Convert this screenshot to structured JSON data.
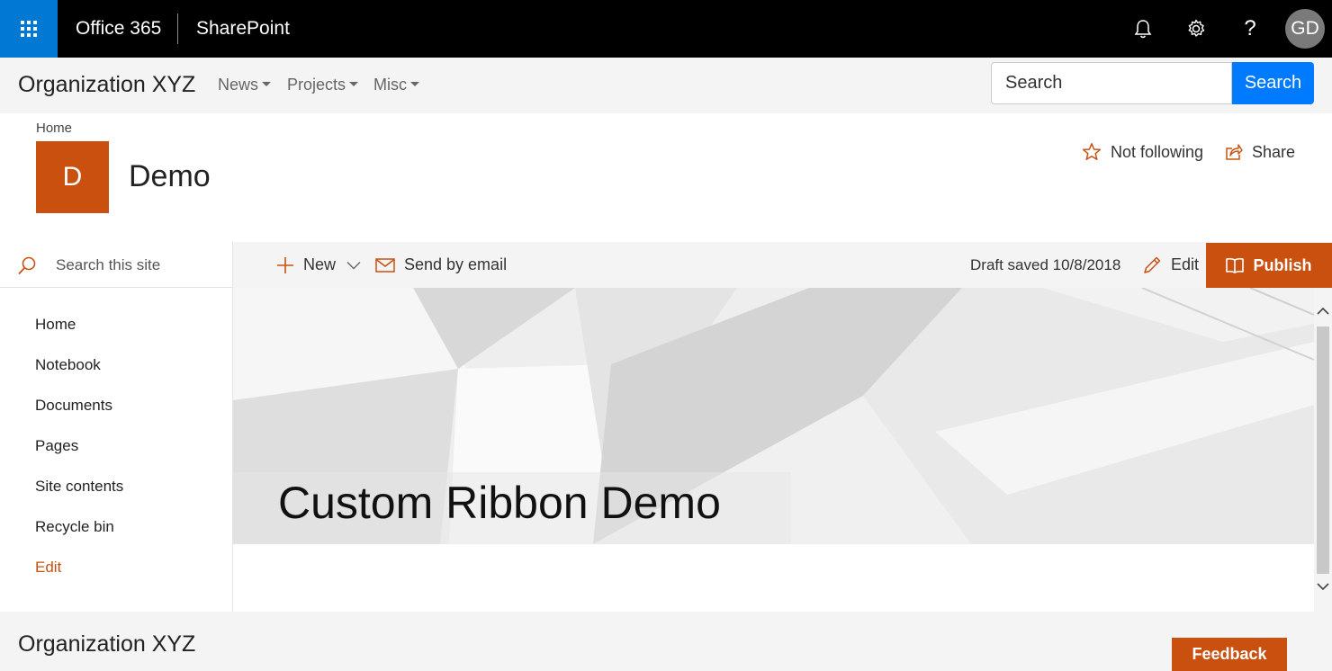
{
  "suitebar": {
    "app_name": "Office 365",
    "product": "SharePoint",
    "icons": [
      "waffle-icon",
      "bell-icon",
      "gear-icon",
      "help-icon"
    ],
    "help_glyph": "?",
    "user_initials": "GD",
    "background": "#000000",
    "waffle_color": "#0078d4"
  },
  "hub": {
    "title": "Organization XYZ",
    "menus": [
      {
        "label": "News"
      },
      {
        "label": "Projects"
      },
      {
        "label": "Misc"
      }
    ],
    "search_placeholder": "Search",
    "search_button": "Search",
    "search_button_color": "#007bff"
  },
  "site": {
    "breadcrumb": "Home",
    "logo_letter": "D",
    "title": "Demo",
    "follow_label": "Not following",
    "share_label": "Share",
    "accent": "#ca5010"
  },
  "leftnav": {
    "search_placeholder": "Search this site",
    "items": [
      {
        "label": "Home"
      },
      {
        "label": "Notebook"
      },
      {
        "label": "Documents"
      },
      {
        "label": "Pages"
      },
      {
        "label": "Site contents"
      },
      {
        "label": "Recycle bin"
      },
      {
        "label": "Edit"
      }
    ]
  },
  "commandbar": {
    "new_label": "New",
    "email_label": "Send by email",
    "draft_status": "Draft saved 10/8/2018",
    "edit_label": "Edit",
    "publish_label": "Publish"
  },
  "hero": {
    "title": "Custom Ribbon Demo"
  },
  "footer": {
    "title": "Organization XYZ",
    "feedback_label": "Feedback"
  }
}
